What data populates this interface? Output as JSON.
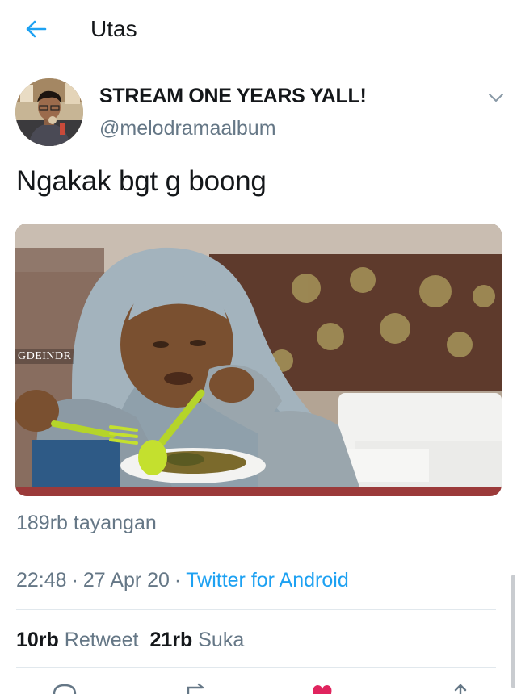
{
  "header": {
    "title": "Utas",
    "back_icon": "arrow-left-icon"
  },
  "tweet": {
    "author": {
      "display_name": "STREAM ONE YEARS YALL!",
      "handle": "@melodramaalbum",
      "avatar": "profile-photo"
    },
    "text": "Ngakak bgt g boong",
    "media": {
      "type": "video",
      "watermark": "GDEINDR"
    },
    "views": "189rb tayangan",
    "meta": {
      "time": "22:48",
      "date": "27 Apr 20",
      "separator": "·",
      "source": "Twitter for Android"
    },
    "stats": {
      "retweets_count": "10rb",
      "retweets_label": "Retweet",
      "likes_count": "21rb",
      "likes_label": "Suka"
    }
  },
  "colors": {
    "accent": "#1da1f2",
    "secondary_text": "#657786",
    "primary_text": "#14171a",
    "divider": "#e1e8ed",
    "like": "#e0245e"
  }
}
